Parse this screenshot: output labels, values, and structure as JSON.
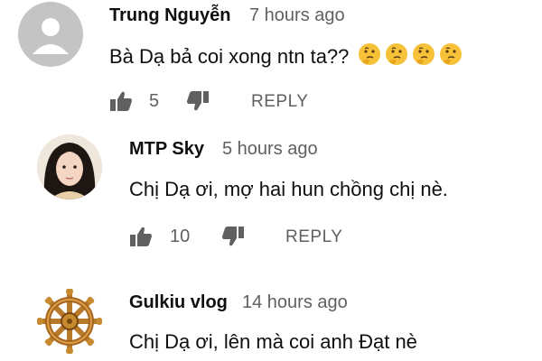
{
  "comments": [
    {
      "author": "Trung Nguyễn",
      "time": "7 hours ago",
      "text": "Bà Dạ bả coi xong ntn ta??",
      "emoji": [
        "🤔",
        "🤔",
        "🤔",
        "🤔"
      ],
      "likes": "5",
      "reply_label": "REPLY",
      "avatar_icon": "default-person-avatar"
    },
    {
      "author": "MTP Sky",
      "time": "5 hours ago",
      "text": "Chị Dạ ơi, mợ hai hun chồng chị nè.",
      "likes": "10",
      "reply_label": "REPLY",
      "avatar_icon": "profile-photo-avatar"
    },
    {
      "author": "Gulkiu vlog",
      "time": "14 hours ago",
      "text": "Chị Dạ ơi, lên mà coi anh Đạt nè",
      "avatar_icon": "dharma-wheel-avatar"
    }
  ],
  "colors": {
    "text": "#0f0f0f",
    "secondary": "#606060",
    "avatar_gray": "#c4c4c4",
    "wheel_gold": "#c88a2e"
  }
}
